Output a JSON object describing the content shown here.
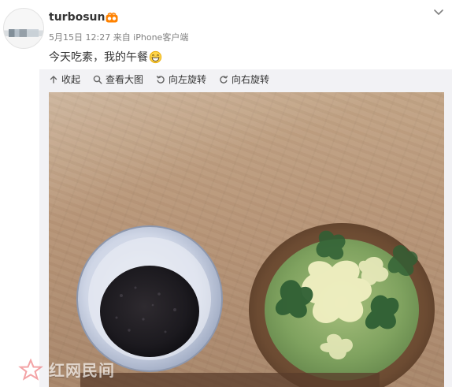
{
  "post": {
    "username": "turbosun",
    "meta": "5月15日 12:27 来自 iPhone客户端",
    "text": "今天吃素，我的午餐"
  },
  "toolbar": {
    "collapse": "收起",
    "view_large": "查看大图",
    "rotate_left": "向左旋转",
    "rotate_right": "向右旋转"
  },
  "watermark": {
    "text": "红网民间"
  },
  "colors": {
    "text_primary": "#333333",
    "text_meta": "#808080",
    "media_bg": "#f2f2f5",
    "accent_orange": "#ff8200"
  },
  "icons": {
    "badge": "vip-badge-icon",
    "dropdown": "chevron-down-icon",
    "collapse": "arrow-up-icon",
    "view": "search-icon",
    "rotate_left": "rotate-left-icon",
    "rotate_right": "rotate-right-icon",
    "emoji": "grin-emoji-icon",
    "watermark_logo": "star-logo-icon"
  }
}
